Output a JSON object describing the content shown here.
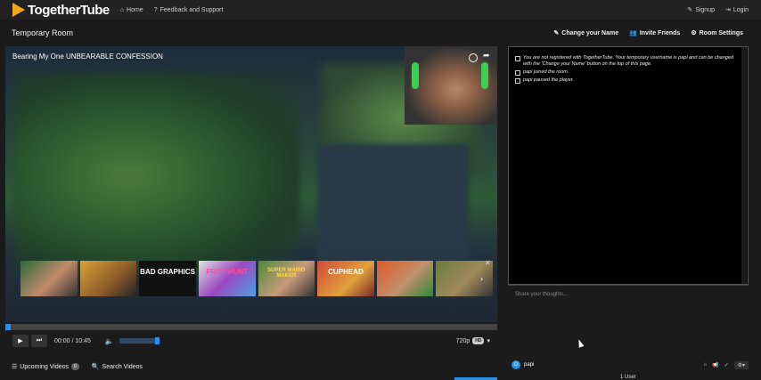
{
  "nav": {
    "brand": "TogetherTube",
    "home": "Home",
    "feedback": "Feedback and Support",
    "signup": "Signup",
    "login": "Login"
  },
  "room": {
    "title": "Temporary Room",
    "change_name": "Change your Name",
    "invite": "Invite Friends",
    "settings": "Room Settings"
  },
  "video": {
    "title": "Bearing My One UNBEARABLE CONFESSION",
    "time": "00:00 / 10:45",
    "quality": "720p",
    "hd": "HD",
    "progress_fraction": 0.01,
    "volume_fraction": 1.0,
    "end_screen": [
      {
        "label": ""
      },
      {
        "label": ""
      },
      {
        "label": "BAD GRAPHICS"
      },
      {
        "label": "PROP HUNT"
      },
      {
        "label": "SUPER MARIO MAKER"
      },
      {
        "label": "CUPHEAD"
      },
      {
        "label": ""
      },
      {
        "label": ""
      }
    ]
  },
  "tabs": {
    "upcoming": "Upcoming Videos",
    "upcoming_count": "0",
    "search": "Search Videos"
  },
  "chat": {
    "messages": [
      "You are not registered with TogetherTube. Your temporary username is papi and can be changed with the 'Change your Name' button on the top of this page.",
      "papi joined the room.",
      "papi paused the player."
    ],
    "input_placeholder": "Share your thoughts...",
    "username": "papi",
    "user_count": "1 User"
  },
  "colors": {
    "accent": "#2b8fe3",
    "logo": "#f4a81d",
    "headset": "#3ecf52"
  }
}
